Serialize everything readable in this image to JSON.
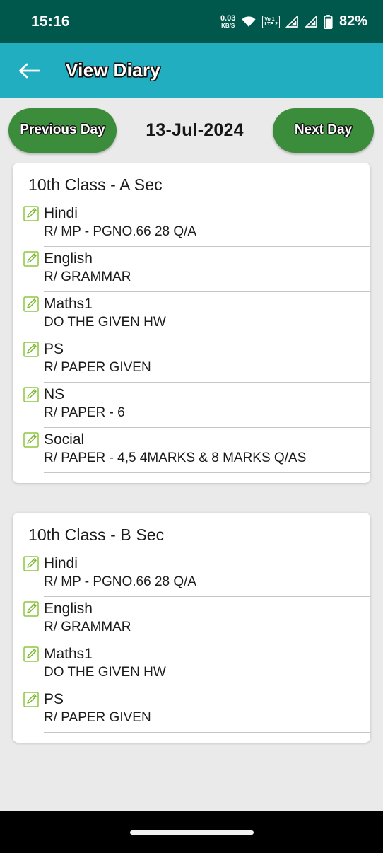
{
  "status_bar": {
    "clock": "15:16",
    "net_speed_value": "0.03",
    "net_speed_unit": "KB/S",
    "wifi_icon": "wifi-icon",
    "volte_label_top": "Vo",
    "volte_label_bottom": "LTE",
    "volte_sim_top": "1",
    "volte_sim_bottom": "2",
    "signal_icon_1": "signal-bars-icon",
    "signal_icon_2": "signal-bars-icon",
    "battery_icon": "battery-icon",
    "battery_percent": "82%",
    "background_color": "#00574b"
  },
  "app_bar": {
    "back_icon": "back-arrow-icon",
    "title": "View Diary",
    "background_color": "#22aec1"
  },
  "date_nav": {
    "previous_label": "Previous Day",
    "next_label": "Next Day",
    "date": "13-Jul-2024",
    "button_color": "#3b8c3b"
  },
  "cards": [
    {
      "title": "10th Class - A Sec",
      "subjects": [
        {
          "icon": "edit-pencil-icon",
          "name": "Hindi",
          "description": "R/ MP - PGNO.66 28 Q/A"
        },
        {
          "icon": "edit-pencil-icon",
          "name": "English",
          "description": "R/ GRAMMAR"
        },
        {
          "icon": "edit-pencil-icon",
          "name": "Maths1",
          "description": "DO THE GIVEN HW"
        },
        {
          "icon": "edit-pencil-icon",
          "name": "PS",
          "description": "R/ PAPER GIVEN"
        },
        {
          "icon": "edit-pencil-icon",
          "name": "NS",
          "description": "R/ PAPER - 6"
        },
        {
          "icon": "edit-pencil-icon",
          "name": "Social",
          "description": "R/ PAPER - 4,5  4MARKS & 8 MARKS Q/AS"
        }
      ]
    },
    {
      "title": "10th Class - B Sec",
      "subjects": [
        {
          "icon": "edit-pencil-icon",
          "name": "Hindi",
          "description": "R/ MP - PGNO.66 28 Q/A"
        },
        {
          "icon": "edit-pencil-icon",
          "name": "English",
          "description": "R/ GRAMMAR"
        },
        {
          "icon": "edit-pencil-icon",
          "name": "Maths1",
          "description": "DO THE GIVEN HW"
        },
        {
          "icon": "edit-pencil-icon",
          "name": "PS",
          "description": "R/ PAPER GIVEN"
        }
      ]
    }
  ],
  "nav_bar": {
    "home_pill": "home-gesture-pill"
  },
  "page_background_color": "#eaeaea"
}
